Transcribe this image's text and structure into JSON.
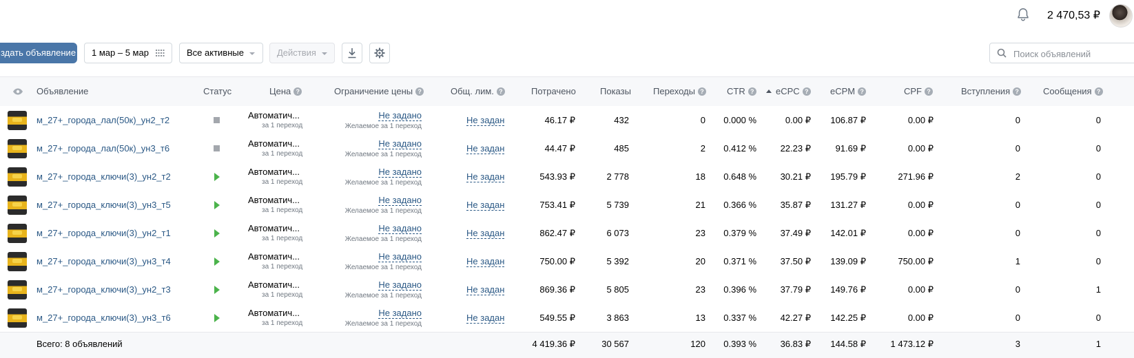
{
  "header": {
    "balance": "2 470,53 ₽"
  },
  "toolbar": {
    "create_label": "здать объявление",
    "date_range": "1 мар – 5 мар",
    "filter": "Все активные",
    "actions": "Действия",
    "search_placeholder": "Поиск объявлений"
  },
  "columns": {
    "ad": "Объявление",
    "status": "Статус",
    "price": "Цена",
    "price_limit": "Ограничение цены",
    "general_limit": "Общ. лим.",
    "spent": "Потрачено",
    "impressions": "Показы",
    "clicks": "Переходы",
    "ctr": "CTR",
    "ecpc": "eCPC",
    "ecpm": "eCPM",
    "cpf": "CPF",
    "joins": "Вступления",
    "messages": "Сообщения"
  },
  "rows": [
    {
      "name": "м_27+_города_лал(50к)_ун2_т2",
      "status": "paused",
      "price": "Автоматич...",
      "price_sub": "за 1 переход",
      "limit": "Не задано",
      "limit_sub": "Желаемое за 1 переход",
      "general": "Не задан",
      "spent": "46.17 ₽",
      "impressions": "432",
      "clicks": "0",
      "ctr": "0.000 %",
      "ecpc": "0.00 ₽",
      "ecpm": "106.87 ₽",
      "cpf": "0.00 ₽",
      "joins": "0",
      "messages": "0"
    },
    {
      "name": "м_27+_города_лал(50к)_ун3_т6",
      "status": "paused",
      "price": "Автоматич...",
      "price_sub": "за 1 переход",
      "limit": "Не задано",
      "limit_sub": "Желаемое за 1 переход",
      "general": "Не задан",
      "spent": "44.47 ₽",
      "impressions": "485",
      "clicks": "2",
      "ctr": "0.412 %",
      "ecpc": "22.23 ₽",
      "ecpm": "91.69 ₽",
      "cpf": "0.00 ₽",
      "joins": "0",
      "messages": "0"
    },
    {
      "name": "м_27+_города_ключи(3)_ун2_т2",
      "status": "active",
      "price": "Автоматич...",
      "price_sub": "за 1 переход",
      "limit": "Не задано",
      "limit_sub": "Желаемое за 1 переход",
      "general": "Не задан",
      "spent": "543.93 ₽",
      "impressions": "2 778",
      "clicks": "18",
      "ctr": "0.648 %",
      "ecpc": "30.21 ₽",
      "ecpm": "195.79 ₽",
      "cpf": "271.96 ₽",
      "joins": "2",
      "messages": "0"
    },
    {
      "name": "м_27+_города_ключи(3)_ун3_т5",
      "status": "active",
      "price": "Автоматич...",
      "price_sub": "за 1 переход",
      "limit": "Не задано",
      "limit_sub": "Желаемое за 1 переход",
      "general": "Не задан",
      "spent": "753.41 ₽",
      "impressions": "5 739",
      "clicks": "21",
      "ctr": "0.366 %",
      "ecpc": "35.87 ₽",
      "ecpm": "131.27 ₽",
      "cpf": "0.00 ₽",
      "joins": "0",
      "messages": "0"
    },
    {
      "name": "м_27+_города_ключи(3)_ун2_т1",
      "status": "active",
      "price": "Автоматич...",
      "price_sub": "за 1 переход",
      "limit": "Не задано",
      "limit_sub": "Желаемое за 1 переход",
      "general": "Не задан",
      "spent": "862.47 ₽",
      "impressions": "6 073",
      "clicks": "23",
      "ctr": "0.379 %",
      "ecpc": "37.49 ₽",
      "ecpm": "142.01 ₽",
      "cpf": "0.00 ₽",
      "joins": "0",
      "messages": "0"
    },
    {
      "name": "м_27+_города_ключи(3)_ун3_т4",
      "status": "active",
      "price": "Автоматич...",
      "price_sub": "за 1 переход",
      "limit": "Не задано",
      "limit_sub": "Желаемое за 1 переход",
      "general": "Не задан",
      "spent": "750.00 ₽",
      "impressions": "5 392",
      "clicks": "20",
      "ctr": "0.371 %",
      "ecpc": "37.50 ₽",
      "ecpm": "139.09 ₽",
      "cpf": "750.00 ₽",
      "joins": "1",
      "messages": "0"
    },
    {
      "name": "м_27+_города_ключи(3)_ун2_т3",
      "status": "active",
      "price": "Автоматич...",
      "price_sub": "за 1 переход",
      "limit": "Не задано",
      "limit_sub": "Желаемое за 1 переход",
      "general": "Не задан",
      "spent": "869.36 ₽",
      "impressions": "5 805",
      "clicks": "23",
      "ctr": "0.396 %",
      "ecpc": "37.79 ₽",
      "ecpm": "149.76 ₽",
      "cpf": "0.00 ₽",
      "joins": "0",
      "messages": "1"
    },
    {
      "name": "м_27+_города_ключи(3)_ун3_т6",
      "status": "active",
      "price": "Автоматич...",
      "price_sub": "за 1 переход",
      "limit": "Не задано",
      "limit_sub": "Желаемое за 1 переход",
      "general": "Не задан",
      "spent": "549.55 ₽",
      "impressions": "3 863",
      "clicks": "13",
      "ctr": "0.337 %",
      "ecpc": "42.27 ₽",
      "ecpm": "142.25 ₽",
      "cpf": "0.00 ₽",
      "joins": "0",
      "messages": "0"
    }
  ],
  "totals": {
    "label": "Всего: 8 объявлений",
    "spent": "4 419.36 ₽",
    "impressions": "30 567",
    "clicks": "120",
    "ctr": "0.393 %",
    "ecpc": "36.83 ₽",
    "ecpm": "144.58 ₽",
    "cpf": "1 473.12 ₽",
    "joins": "3",
    "messages": "1"
  },
  "icons": {
    "notifications": "bell-icon",
    "download": "download-icon",
    "settings": "gear-icon",
    "search": "search-icon",
    "visibility": "eye-icon",
    "calendar": "calendar-grid-icon"
  },
  "colors": {
    "primary": "#4a76a8",
    "link": "#2a5885",
    "active": "#4bb34b",
    "paused": "#a3a7ad"
  }
}
